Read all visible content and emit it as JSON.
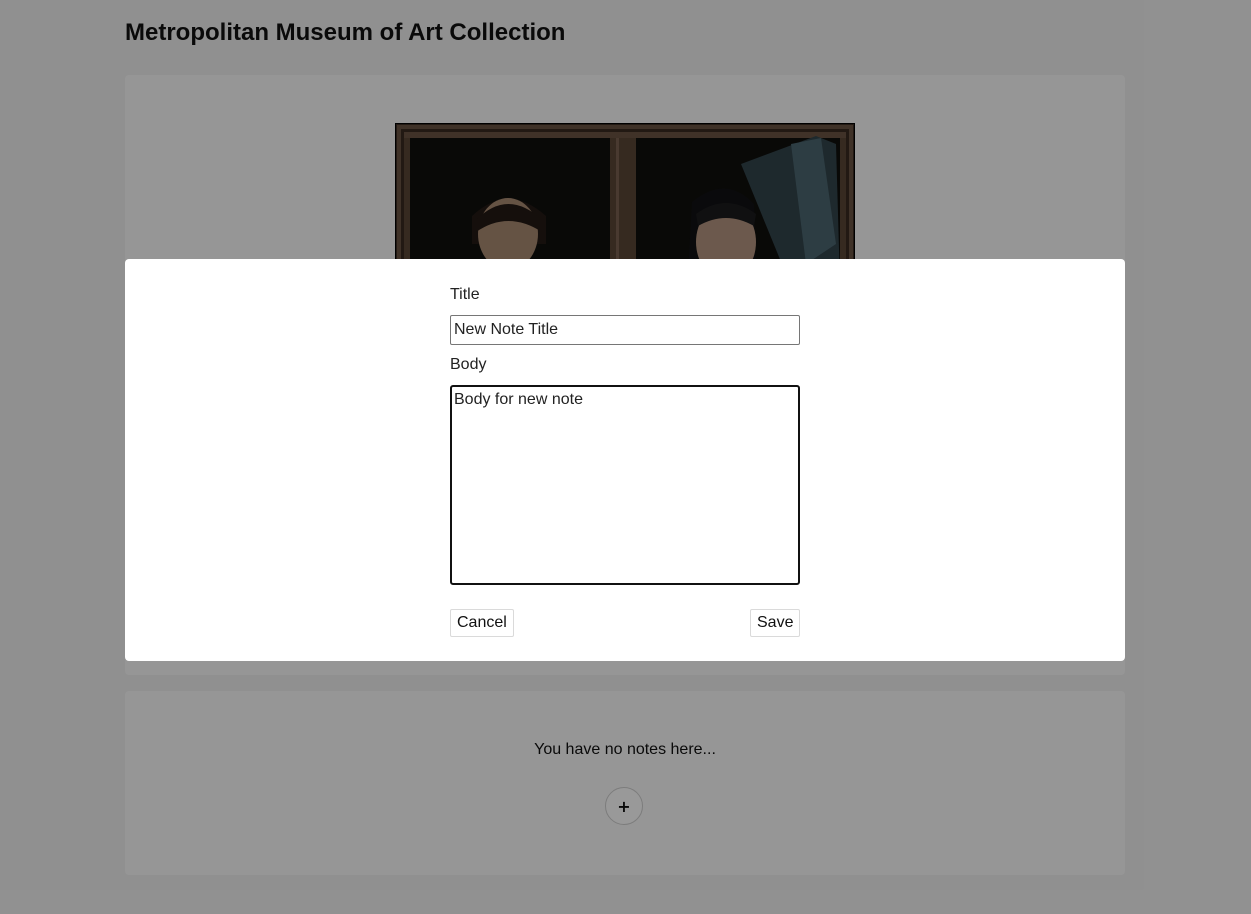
{
  "header": {
    "title": "Metropolitan Museum of Art Collection"
  },
  "artwork": {
    "icon": "painting-image"
  },
  "notes": {
    "empty_message": "You have no notes here...",
    "add_label": "+"
  },
  "modal": {
    "title_label": "Title",
    "title_value": "New Note Title",
    "body_label": "Body",
    "body_value": "Body for new note",
    "cancel_label": "Cancel",
    "save_label": "Save"
  },
  "colors": {
    "overlay": "#000000",
    "modal_background": "#ffffff",
    "page_background": "#f1f1f1"
  }
}
